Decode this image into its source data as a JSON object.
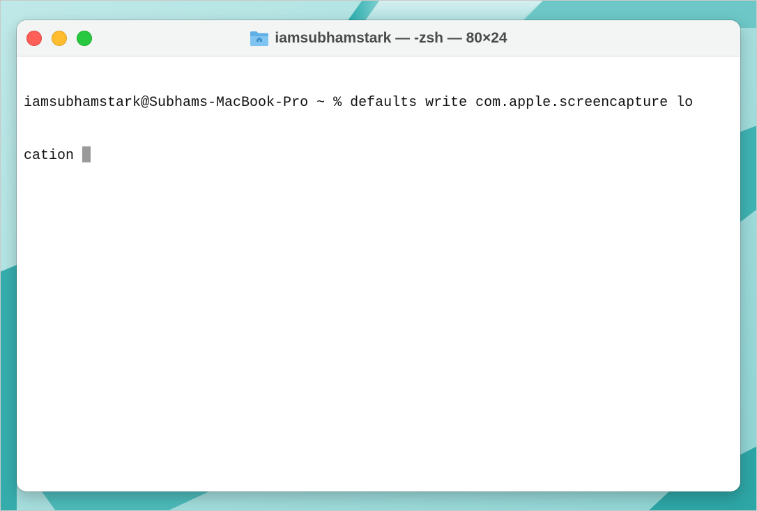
{
  "window": {
    "title": "iamsubhamstark — -zsh — 80×24",
    "folder_icon": "home-folder-icon"
  },
  "traffic_lights": {
    "close": "#fe5f57",
    "minimize": "#febc2e",
    "zoom": "#28c840"
  },
  "terminal": {
    "line1": "iamsubhamstark@Subhams-MacBook-Pro ~ % defaults write com.apple.screencapture lo",
    "line2": "cation "
  },
  "colors": {
    "wallpaper_base": "#9fdcdc",
    "wallpaper_dark": "#3fb3b3",
    "cursor": "#9a9a9a"
  }
}
